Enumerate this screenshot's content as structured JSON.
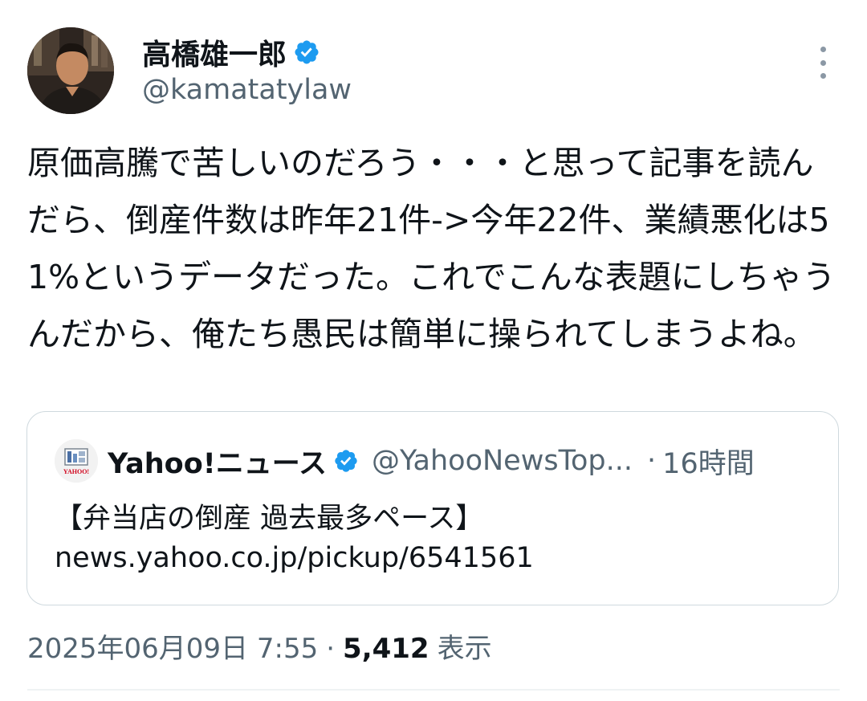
{
  "author": {
    "display_name": "高橋雄一郎",
    "handle": "@kamatatylaw",
    "verified_icon": "verified-badge-icon",
    "verified_color": "#1d9bf0"
  },
  "tweet": {
    "text": "原価高騰で苦しいのだろう・・・と思って記事を読んだら、倒産件数は昨年21件->今年22件、業績悪化は51%というデータだった。これでこんな表題にしちゃうんだから、俺たち愚民は簡単に操られてしまうよね。"
  },
  "quote": {
    "display_name": "Yahoo!ニュース",
    "handle": "@YahooNewsTop...",
    "separator": "·",
    "time": "16時間",
    "headline": "【弁当店の倒産 過去最多ペース】",
    "link": "news.yahoo.co.jp/pickup/6541561",
    "logo_text": "YAHOO!"
  },
  "meta": {
    "timestamp": "2025年06月09日 7:55",
    "dot": "·",
    "views_count": "5,412",
    "views_label": "表示"
  },
  "colors": {
    "text_primary": "#0f1419",
    "text_secondary": "#536471",
    "border": "#cfd9de",
    "verified": "#1d9bf0"
  }
}
